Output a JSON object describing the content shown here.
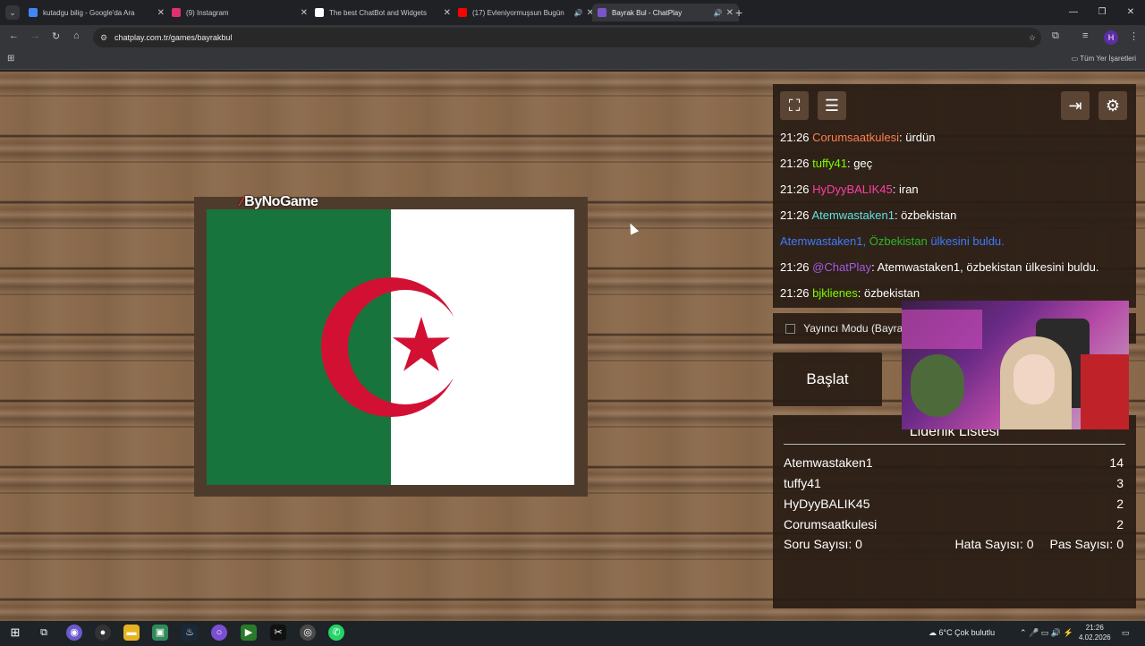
{
  "browser": {
    "tabs": [
      {
        "title": "kutadgu bilig - Google'da Ara",
        "favicon_color": "#4285f4",
        "audio": false
      },
      {
        "title": "(9) Instagram",
        "favicon_color": "#e1306c",
        "audio": false
      },
      {
        "title": "The best ChatBot and Widgets",
        "favicon_color": "#ffffff",
        "audio": false
      },
      {
        "title": "(17) Evleniyormuşsun Bugün",
        "favicon_color": "#ff0000",
        "audio": true
      },
      {
        "title": "Bayrak Bul - ChatPlay",
        "favicon_color": "#7a55c9",
        "audio": true
      }
    ],
    "active_tab": 4,
    "url": "chatplay.com.tr/games/bayrakbul",
    "bookmarks_label": "Tüm Yer İşaretleri",
    "profile_initial": "H"
  },
  "game": {
    "brand": "ByNoGame",
    "flag": {
      "left_color": "#17743c",
      "right_color": "#ffffff",
      "emblem_color": "#d21034"
    }
  },
  "chat": [
    {
      "time": "21:26",
      "user": "Corumsaatkulesi",
      "color": "#ff7f50",
      "message": ": ürdün"
    },
    {
      "time": "21:26",
      "user": "tuffy41",
      "color": "#7cfc00",
      "message": ": geç"
    },
    {
      "time": "21:26",
      "user": "HyDyyBALIK45",
      "color": "#ff3ea5",
      "message": ": iran"
    },
    {
      "time": "21:26",
      "user": "Atemwastaken1",
      "color": "#5fe0e6",
      "message": ": özbekistan"
    },
    {
      "time": "",
      "user": "",
      "color": "",
      "message": "",
      "system": true,
      "parts": [
        {
          "text": "Atemwastaken1,",
          "color": "#3d7bff"
        },
        {
          "text": " Özbekistan",
          "color": "#2bb52b"
        },
        {
          "text": " ülkesini buldu.",
          "color": "#3d7bff"
        }
      ]
    },
    {
      "time": "21:26",
      "user": "@ChatPlay",
      "color": "#a25ae6",
      "message": ": Atemwastaken1, özbekistan ülkesini buldu."
    },
    {
      "time": "21:26",
      "user": "bjklienes",
      "color": "#7cfc00",
      "message": ": özbekistan"
    }
  ],
  "controls": {
    "streamer_mode_label": "Yayıncı Modu (Bayra",
    "start_label": "Başlat"
  },
  "leaderboard": {
    "title": "Liderlik Listesi",
    "rows": [
      {
        "name": "Atemwastaken1",
        "score": "14"
      },
      {
        "name": "tuffy41",
        "score": "3"
      },
      {
        "name": "HyDyyBALIK45",
        "score": "2"
      },
      {
        "name": "Corumsaatkulesi",
        "score": "2"
      }
    ],
    "question_count_label": "Soru Sayısı:",
    "question_count": "0",
    "error_count_label": "Hata Sayısı:",
    "error_count": "0",
    "pass_count_label": "Pas Sayısı:",
    "pass_count": "0"
  },
  "taskbar": {
    "weather": "6°C  Çok bulutlu",
    "time": "21:26",
    "date": "4.02.2026"
  }
}
